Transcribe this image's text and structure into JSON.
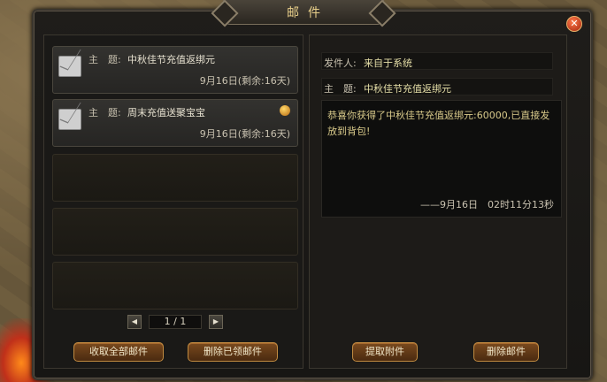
{
  "window": {
    "title": "邮件"
  },
  "mail_list": [
    {
      "subject_label": "主　题:",
      "subject": "中秋佳节充值返绑元",
      "date": "9月16日(剩余:16天)",
      "has_attachment": false
    },
    {
      "subject_label": "主　题:",
      "subject": "周末充值送聚宝宝",
      "date": "9月16日(剩余:16天)",
      "has_attachment": true
    }
  ],
  "pager": {
    "prev": "◀",
    "text": "1 / 1",
    "next": "▶"
  },
  "left_buttons": {
    "collect_all": "收取全部邮件",
    "delete_read": "删除已领邮件"
  },
  "detail": {
    "sender_label": "发件人:",
    "sender": "来自于系统",
    "subject_label": "主　题:",
    "subject": "中秋佳节充值返绑元",
    "body": "恭喜你获得了中秋佳节充值返绑元:60000,已直接发放到背包!",
    "timestamp": "——9月16日　02时11分13秒"
  },
  "right_buttons": {
    "take_attachment": "提取附件",
    "delete_mail": "删除邮件"
  },
  "colors": {
    "accent": "#c08a40",
    "title": "#e8cf8a"
  }
}
